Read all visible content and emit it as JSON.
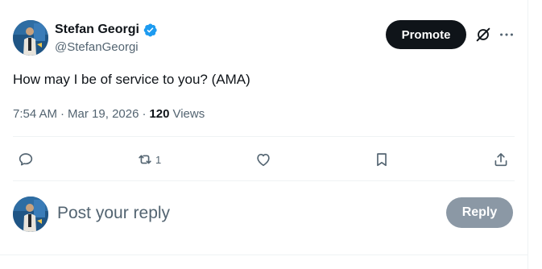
{
  "author": {
    "display_name": "Stefan Georgi",
    "handle": "@StefanGeorgi",
    "verified": true
  },
  "header_actions": {
    "promote_label": "Promote",
    "grok_icon": "grok-slash-icon",
    "more_icon": "more-dots-icon"
  },
  "tweet": {
    "text": "How may I be of service to you? (AMA)",
    "time": "7:54 AM",
    "date": "Mar 19, 2026",
    "separator": "·",
    "views_count": "120",
    "views_label": "Views"
  },
  "actions": {
    "reply_icon": "reply-bubble-icon",
    "retweet_icon": "retweet-icon",
    "retweet_count": "1",
    "like_icon": "heart-icon",
    "bookmark_icon": "bookmark-icon",
    "share_icon": "share-upload-icon"
  },
  "reply_composer": {
    "placeholder": "Post your reply",
    "button_label": "Reply"
  },
  "colors": {
    "text_primary": "#0f1419",
    "text_secondary": "#536471",
    "verified_blue": "#1d9bf0",
    "promote_bg": "#0f1419",
    "reply_button_disabled": "#8b98a5",
    "divider": "#eff3f4"
  }
}
